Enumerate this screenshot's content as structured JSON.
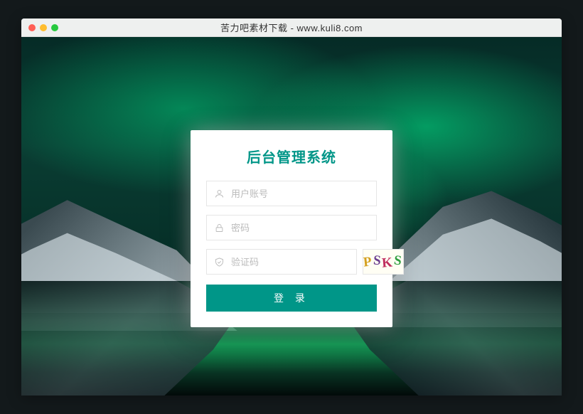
{
  "browser": {
    "title": "苦力吧素材下载 - www.kuli8.com"
  },
  "login": {
    "title": "后台管理系统",
    "username": {
      "placeholder": "用户账号",
      "value": ""
    },
    "password": {
      "placeholder": "密码",
      "value": ""
    },
    "captcha": {
      "placeholder": "验证码",
      "value": "",
      "code": "PSKS"
    },
    "submit_label": "登 录"
  },
  "colors": {
    "accent": "#009688"
  }
}
